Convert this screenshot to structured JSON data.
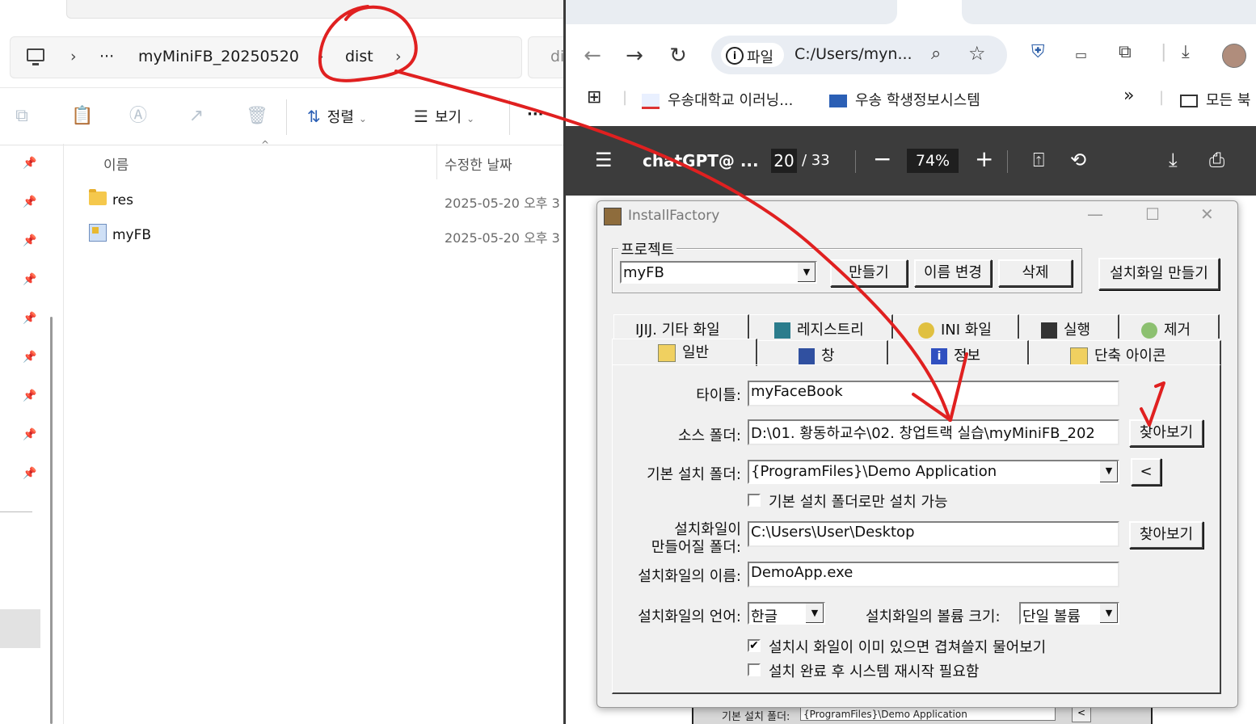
{
  "explorer": {
    "breadcrumb": {
      "overflow": "···",
      "folder1": "myMiniFB_20250520",
      "folder2": "dist",
      "next_partial": "di"
    },
    "toolbar": {
      "sort_label": "정렬",
      "view_label": "보기",
      "more": "···"
    },
    "columns": {
      "name": "이름",
      "modified": "수정한 날짜"
    },
    "files": [
      {
        "name": "res",
        "date": "2025-05-20 오후 3",
        "type": "folder"
      },
      {
        "name": "myFB",
        "date": "2025-05-20 오후 3",
        "type": "app"
      }
    ]
  },
  "browser": {
    "omnibox": {
      "chip_label": "파일",
      "url": "C:/Users/myn..."
    },
    "bookmarks": [
      "우송대학교 이러닝...",
      "우송 학생정보시스템",
      "모든 북"
    ],
    "bookmarks_more": "»",
    "pdf": {
      "title": "chatGPT@ ...",
      "page": "20",
      "total": "/ 33",
      "zoom": "74%"
    },
    "behind_row": {
      "label": "기본 설치 폴더:",
      "value": "{ProgramFiles}\\Demo Application",
      "btn": "<"
    }
  },
  "dialog": {
    "title": "InstallFactory",
    "project": {
      "legend": "프로젝트",
      "selected": "myFB",
      "make": "만들기",
      "rename": "이름 변경",
      "delete": "삭제",
      "build": "설치화일 만들기"
    },
    "tabs_row1": [
      "기타 화일",
      "레지스트리",
      "INI 화일",
      "실행",
      "제거"
    ],
    "tabs_row2": [
      "일반",
      "창",
      "정보",
      "단축 아이콘"
    ],
    "form": {
      "title_label": "타이틀:",
      "title_value": "myFaceBook",
      "source_label": "소스 폴더:",
      "source_value": "D:\\01. 황동하교수\\02. 창업트랙 실습\\myMiniFB_202",
      "browse": "찾아보기",
      "default_label": "기본 설치 폴더:",
      "default_value": "{ProgramFiles}\\Demo Application",
      "back_btn": "<",
      "only_default": "기본 설치 폴더로만 설치 가능",
      "output_label_1": "설치화일이",
      "output_label_2": "만들어질 폴더:",
      "output_value": "C:\\Users\\User\\Desktop",
      "browse2": "찾아보기",
      "filename_label": "설치화일의 이름:",
      "filename_value": "DemoApp.exe",
      "lang_label": "설치화일의 언어:",
      "lang_value": "한글",
      "volume_label": "설치화일의 볼륨 크기:",
      "volume_value": "단일 볼륨",
      "overwrite_label": "설치시 화일이 이미 있으면 겹쳐쓸지 물어보기",
      "overwrite_checked": "✔",
      "reboot_label": "설치 완료 후 시스템 재시작 필요함"
    }
  },
  "colors": {
    "annotation": "#e02020",
    "pdf_bar": "#3c3c3c",
    "dialog_bg": "#f0f0f0"
  }
}
